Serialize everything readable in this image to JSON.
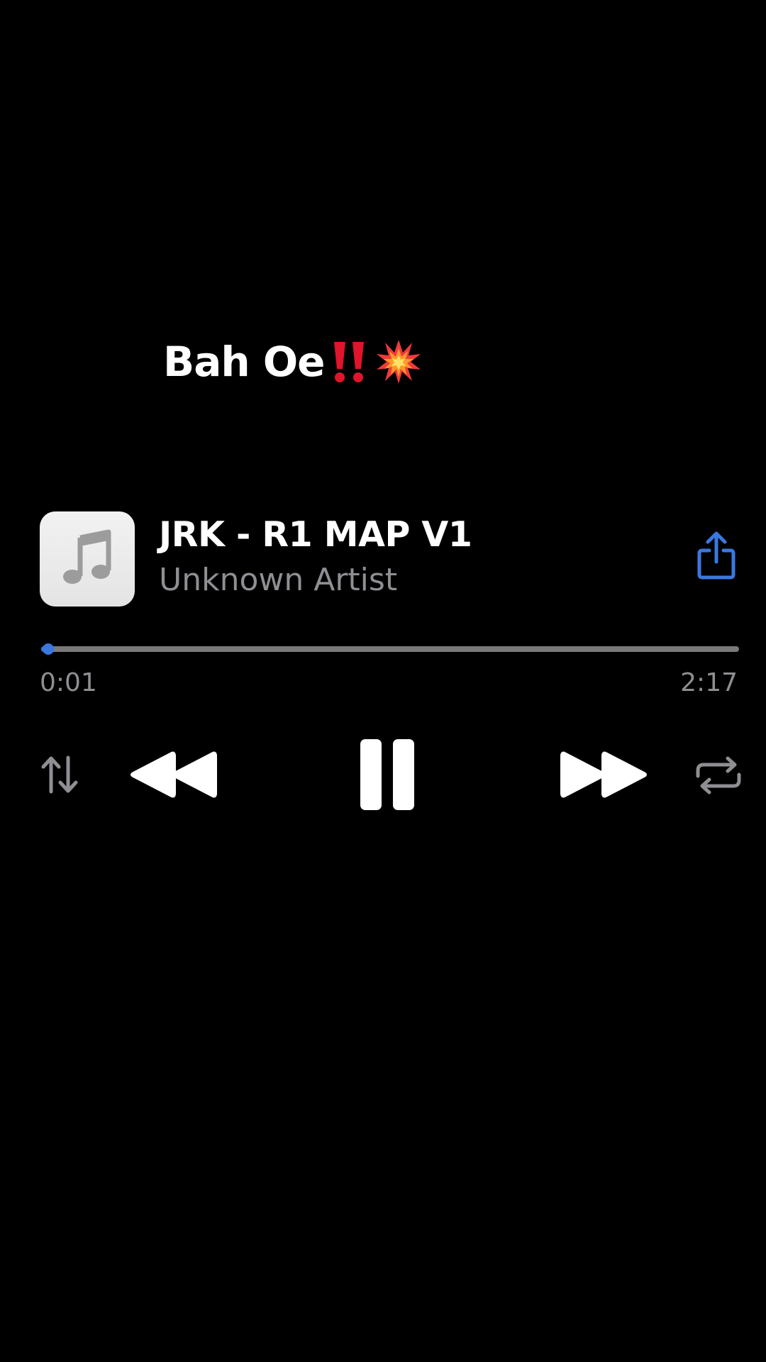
{
  "caption": {
    "text": "Bah Oe",
    "emojis": [
      "double-exclamation-icon",
      "collision-icon"
    ]
  },
  "track": {
    "artwork_icon": "music-note-icon",
    "title": "JRK - R1 MAP V1",
    "artist": "Unknown Artist"
  },
  "actions": {
    "share_icon": "share-icon"
  },
  "playback": {
    "elapsed": "0:01",
    "duration": "2:17",
    "progress_fraction": 0.01,
    "state": "playing"
  },
  "controls": [
    {
      "name": "sort-order",
      "icon": "up-down-arrows-icon"
    },
    {
      "name": "rewind",
      "icon": "rewind-icon"
    },
    {
      "name": "pause",
      "icon": "pause-icon"
    },
    {
      "name": "fast-forward",
      "icon": "fast-forward-icon"
    },
    {
      "name": "repeat",
      "icon": "repeat-icon"
    }
  ],
  "colors": {
    "background": "#000000",
    "accent": "#3a78e0",
    "secondary_text": "#8e8e93",
    "track": "#7a7a7a"
  }
}
